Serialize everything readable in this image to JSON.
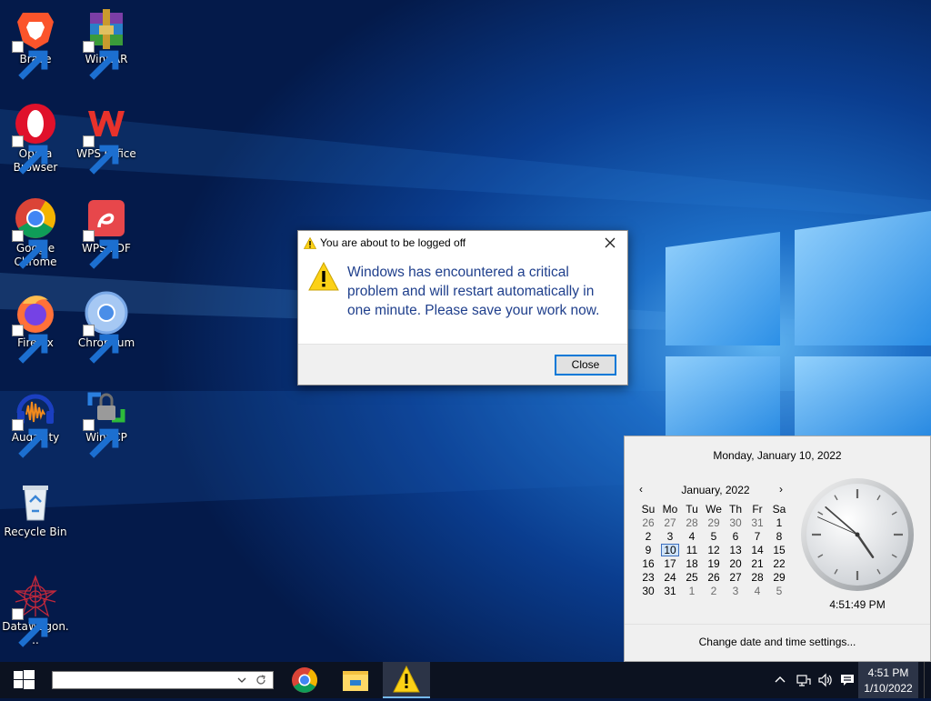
{
  "desktop": {
    "icons": [
      {
        "label": "Brave",
        "icon": "brave-icon"
      },
      {
        "label": "WinRAR",
        "icon": "winrar-icon"
      },
      {
        "label": "Opera\nBrowser",
        "icon": "opera-icon"
      },
      {
        "label": "WPS Office",
        "icon": "wps-office-icon"
      },
      {
        "label": "Google\nChrome",
        "icon": "chrome-icon"
      },
      {
        "label": "WPS PDF",
        "icon": "wps-pdf-icon"
      },
      {
        "label": "Firefox",
        "icon": "firefox-icon"
      },
      {
        "label": "Chromium",
        "icon": "chromium-icon"
      },
      {
        "label": "Audacity",
        "icon": "audacity-icon"
      },
      {
        "label": "WinSCP",
        "icon": "winscp-icon"
      },
      {
        "label": "Recycle Bin",
        "icon": "recycle-bin-icon"
      },
      {
        "label": "DataWagon...",
        "icon": "datawagon-icon"
      }
    ]
  },
  "dialog": {
    "title": "You are about to be logged off",
    "message": "Windows has encountered a critical problem and will restart automatically in one minute. Please save your work now.",
    "close_button": "Close",
    "close_icon": "close-icon",
    "icon": "warning-icon"
  },
  "flyout": {
    "header": "Monday, January 10, 2022",
    "month_label": "January, 2022",
    "prev": "‹",
    "next": "›",
    "weekdays": [
      "Su",
      "Mo",
      "Tu",
      "We",
      "Th",
      "Fr",
      "Sa"
    ],
    "weeks": [
      [
        "26",
        "27",
        "28",
        "29",
        "30",
        "31",
        "1"
      ],
      [
        "2",
        "3",
        "4",
        "5",
        "6",
        "7",
        "8"
      ],
      [
        "9",
        "10",
        "11",
        "12",
        "13",
        "14",
        "15"
      ],
      [
        "16",
        "17",
        "18",
        "19",
        "20",
        "21",
        "22"
      ],
      [
        "23",
        "24",
        "25",
        "26",
        "27",
        "28",
        "29"
      ],
      [
        "30",
        "31",
        "1",
        "2",
        "3",
        "4",
        "5"
      ]
    ],
    "today": "10",
    "time": "4:51:49 PM",
    "clock": {
      "hours": 4,
      "minutes": 51,
      "seconds": 49
    },
    "settings_link": "Change date and time settings..."
  },
  "taskbar": {
    "search_value": "",
    "apps": [
      {
        "name": "chrome-icon"
      },
      {
        "name": "file-explorer-icon"
      },
      {
        "name": "warning-icon"
      }
    ],
    "tray": [
      "chevron-up-icon",
      "network-icon",
      "volume-icon",
      "notification-icon"
    ],
    "time": "4:51 PM",
    "date": "1/10/2022"
  },
  "colors": {
    "dialog_message": "#1f3f8c",
    "button_focus_border": "#0078d7",
    "taskbar": "#0c1220",
    "accent": "#76b9ed"
  }
}
